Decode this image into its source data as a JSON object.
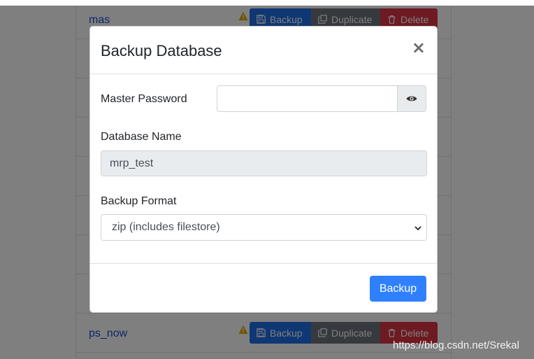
{
  "db_list": [
    {
      "name": "mas",
      "backup_label": "Backup",
      "duplicate_label": "Duplicate",
      "delete_label": "Delete"
    },
    {
      "name": "ps_now",
      "backup_label": "Backup",
      "duplicate_label": "Duplicate",
      "delete_label": "Delete"
    }
  ],
  "modal": {
    "title": "Backup Database",
    "close_glyph": "×",
    "master_password_label": "Master Password",
    "master_password_value": "",
    "database_name_label": "Database Name",
    "database_name_value": "mrp_test",
    "backup_format_label": "Backup Format",
    "backup_format_selected": "zip (includes filestore)",
    "submit_label": "Backup"
  },
  "watermark": "https://blog.csdn.net/Srekal",
  "colors": {
    "primary": "#2f80ff",
    "secondary": "#6c757d",
    "danger": "#dc3545",
    "warning": "#f0ad4e",
    "link": "#1a4fd6"
  },
  "icons": {
    "warning": "warning-icon",
    "backup": "floppy-disk-icon",
    "duplicate": "copy-icon",
    "delete": "trash-icon",
    "password_toggle": "eye-icon",
    "select": "chevron-down-icon"
  }
}
